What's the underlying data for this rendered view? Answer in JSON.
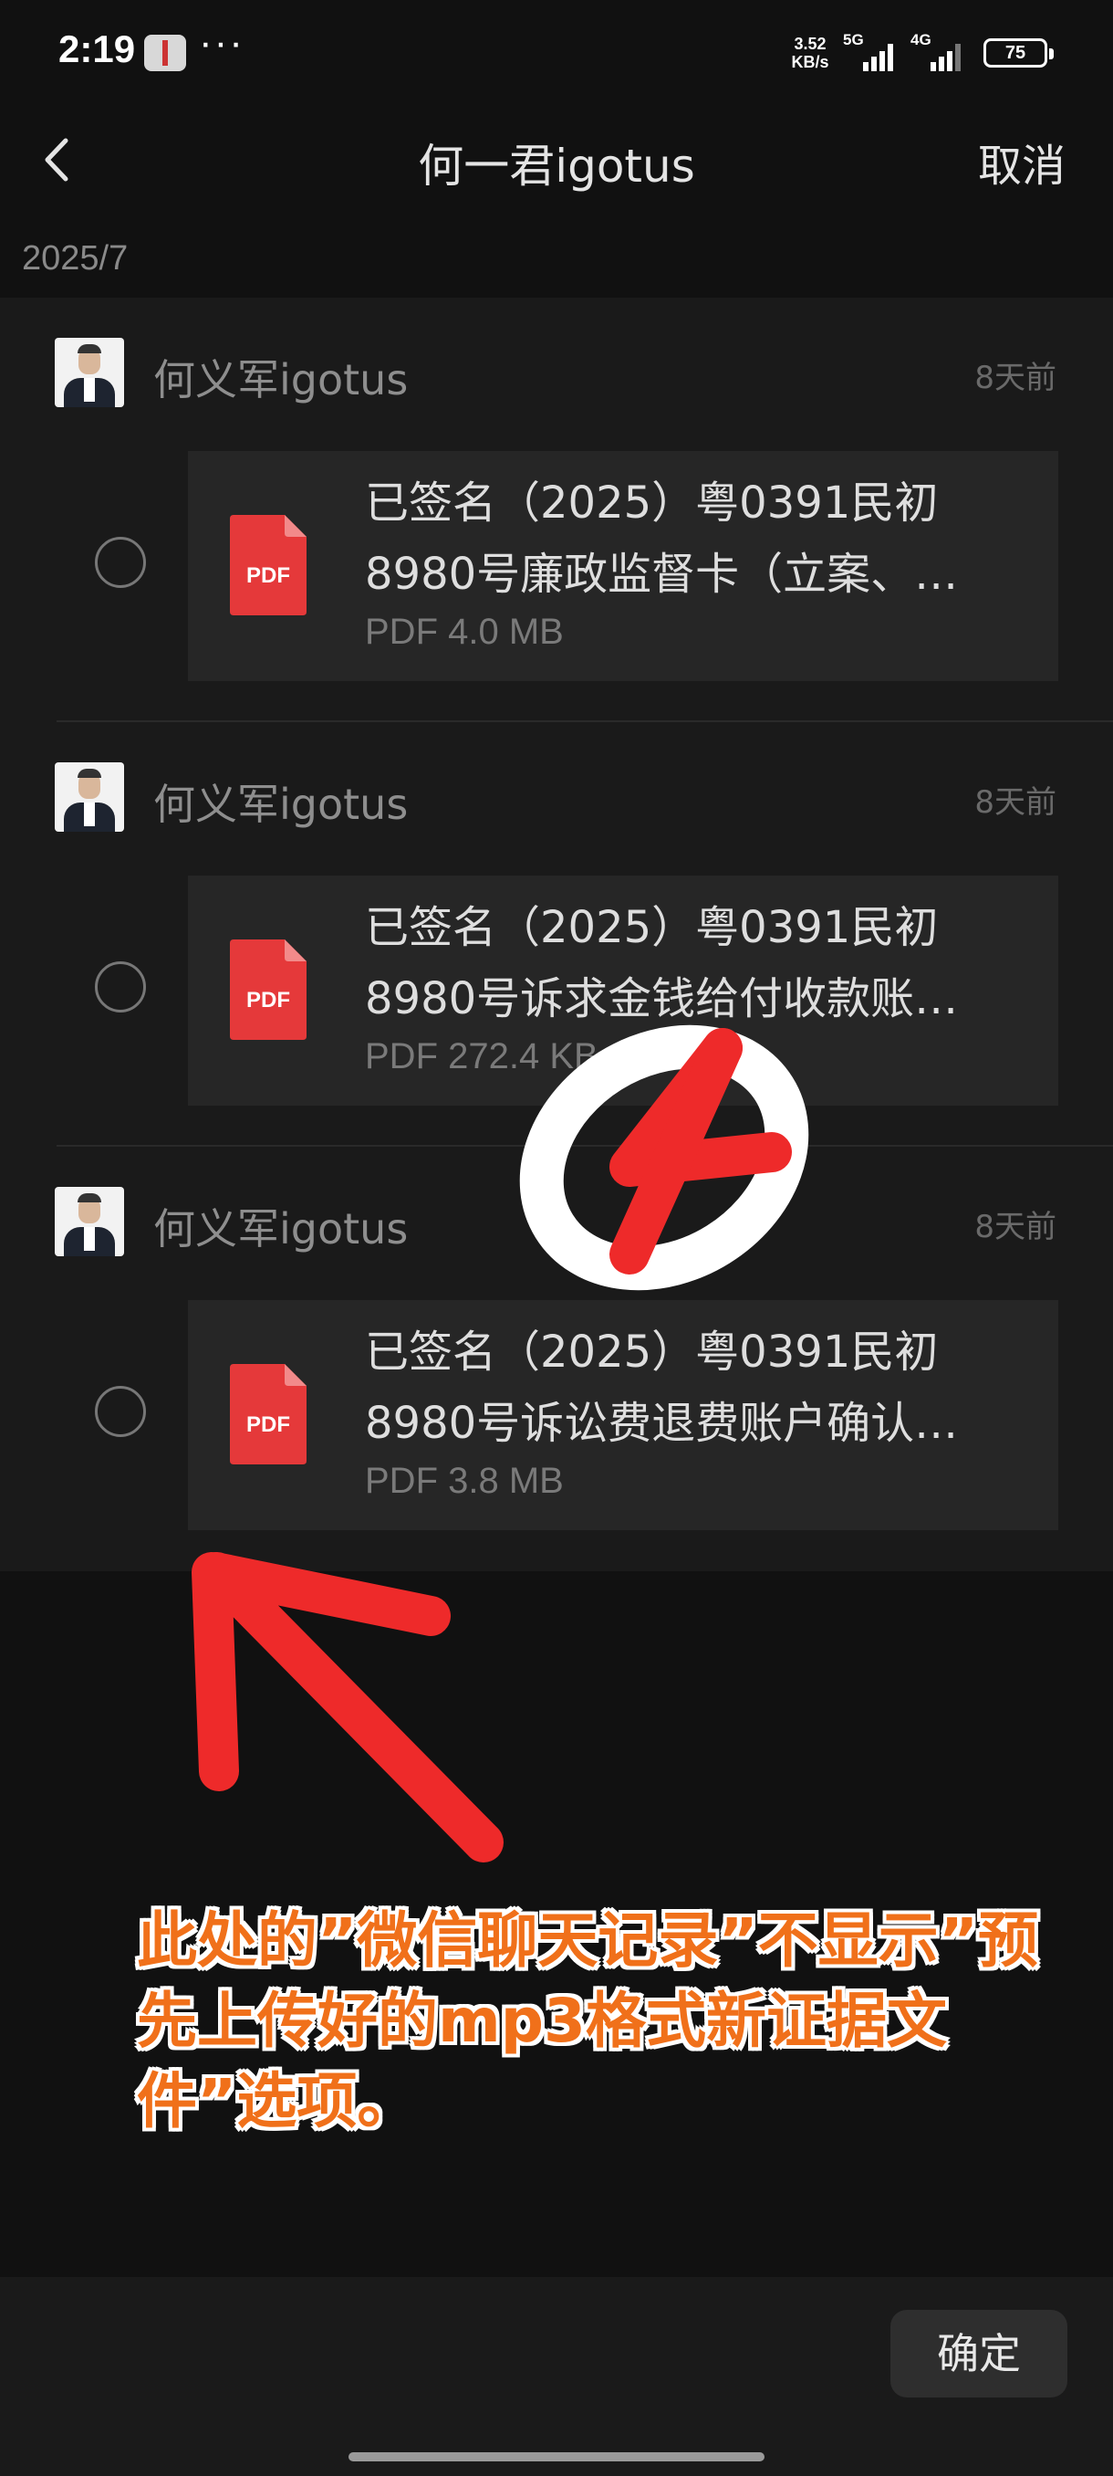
{
  "status_bar": {
    "time": "2:19",
    "dots": "···",
    "net_speed": "3.52",
    "net_unit": "KB/s",
    "sig1_label": "5G",
    "sig2_label": "4G",
    "battery": "75"
  },
  "header": {
    "title": "何一君igotus",
    "cancel_label": "取消"
  },
  "month_label": "2025/7",
  "messages": [
    {
      "sender": "何义军igotus",
      "time": "8天前",
      "file_line1": "已签名（2025）粤0391民初",
      "file_line2": "8980号廉政监督卡（立案、…",
      "file_meta": "PDF 4.0 MB",
      "pdf_label": "PDF"
    },
    {
      "sender": "何义军igotus",
      "time": "8天前",
      "file_line1": "已签名（2025）粤0391民初",
      "file_line2": "8980号诉求金钱给付收款账…",
      "file_meta": "PDF 272.4 KB",
      "pdf_label": "PDF"
    },
    {
      "sender": "何义军igotus",
      "time": "8天前",
      "file_line1": "已签名（2025）粤0391民初",
      "file_line2": "8980号诉讼费退费账户确认…",
      "file_meta": "PDF 3.8 MB",
      "pdf_label": "PDF"
    }
  ],
  "confirm_label": "确定",
  "annotation": {
    "text": "此处的”微信聊天记录”不显示”预先上传好的mp3格式新证据文件”选项。",
    "text_color": "#f0701a",
    "mark_color": "#ee2a2a"
  }
}
